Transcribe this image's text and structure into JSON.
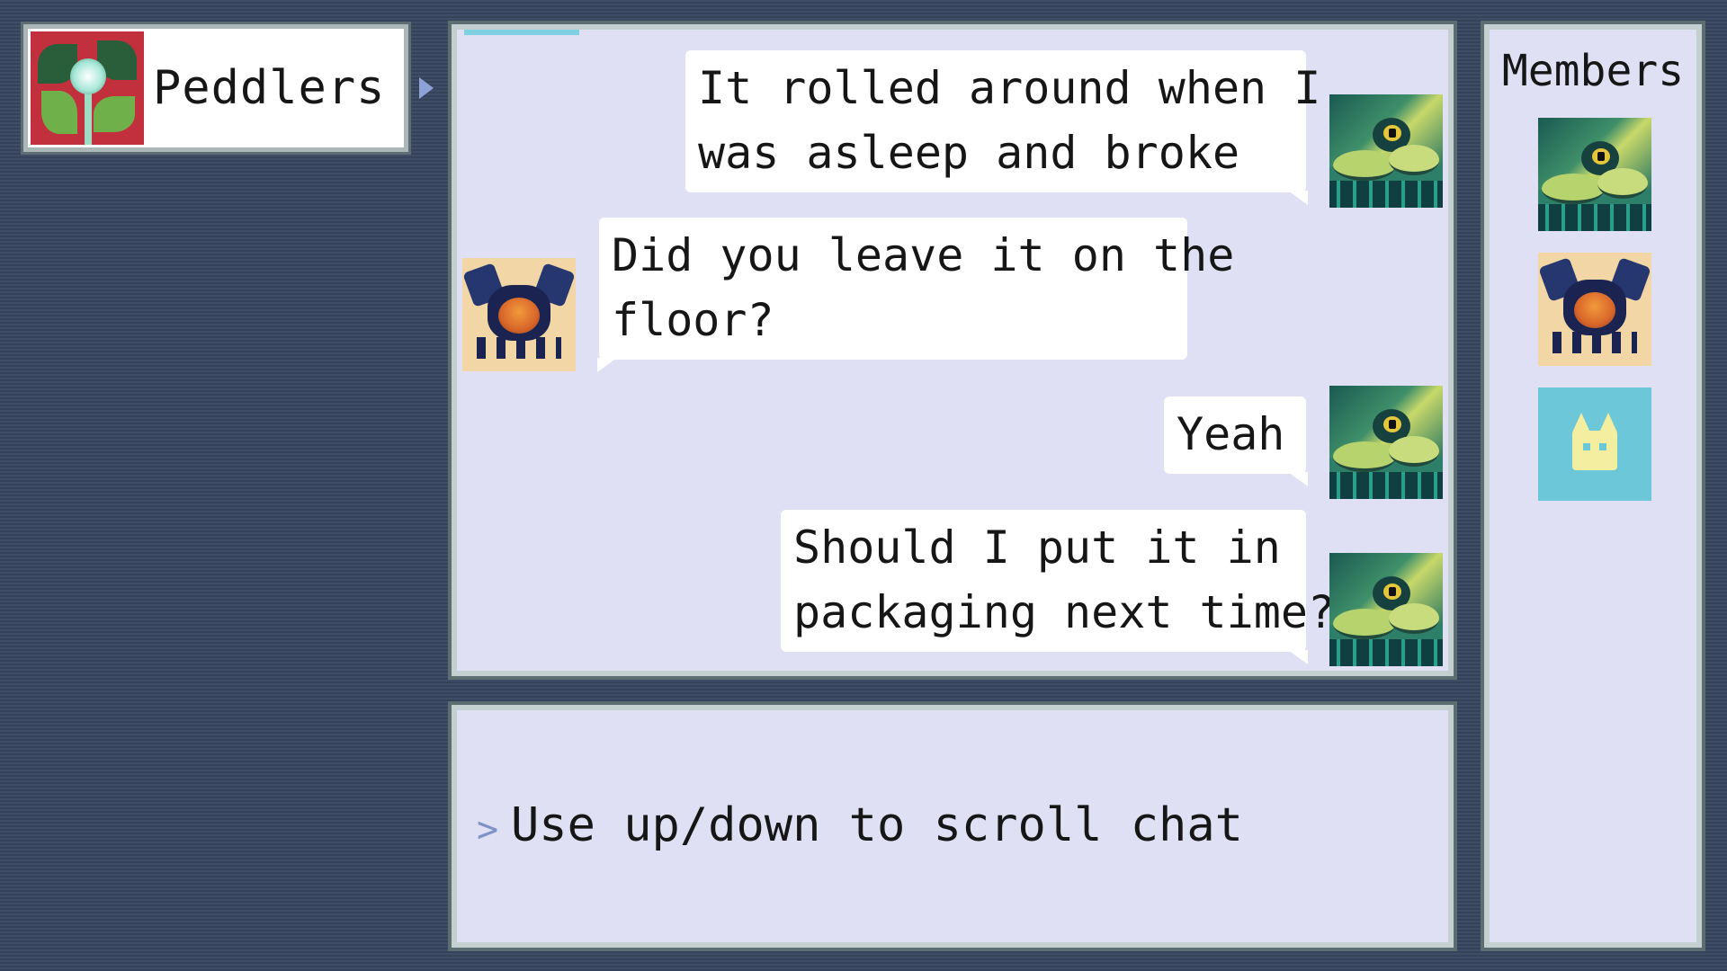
{
  "group": {
    "name": "Peddlers",
    "icon": "plant-icon"
  },
  "chat": {
    "messages": [
      {
        "sender": "self",
        "avatar": "frog-avatar-icon",
        "text": "It rolled around when I\nwas asleep and broke"
      },
      {
        "sender": "other",
        "avatar": "beetle-avatar-icon",
        "text": "Did you leave it on the\nfloor?"
      },
      {
        "sender": "self",
        "avatar": "frog-avatar-icon",
        "text": "Yeah"
      },
      {
        "sender": "self",
        "avatar": "frog-avatar-icon",
        "text": "Should I put it in\npackaging next time?"
      }
    ]
  },
  "input": {
    "hint": "Use up/down to scroll chat"
  },
  "members": {
    "title": "Members",
    "avatars": [
      "frog-avatar-icon",
      "beetle-avatar-icon",
      "cat-avatar-icon"
    ]
  },
  "colors": {
    "background": "#3d4a64",
    "panel": "#dfe0f4",
    "bubble": "#ffffff",
    "accent": "#8ea2d8",
    "scroll_indicator": "#7fd0e0"
  }
}
